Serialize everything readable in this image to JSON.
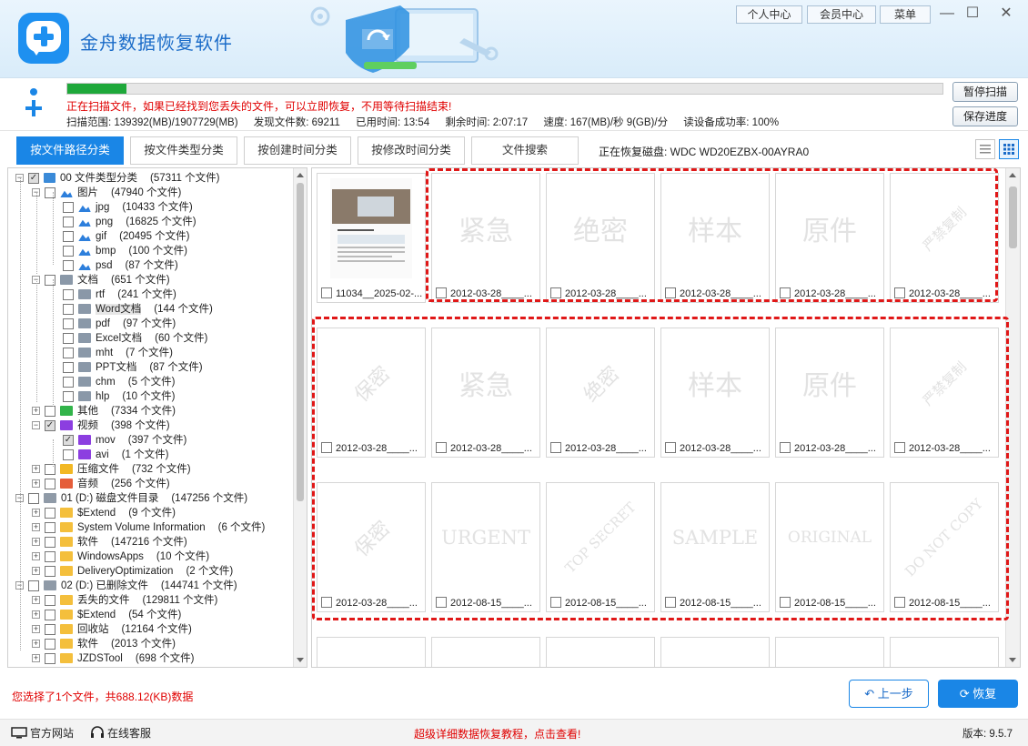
{
  "app": {
    "title": "金舟数据恢复软件",
    "header_buttons": [
      "个人中心",
      "会员中心",
      "菜单"
    ],
    "window_controls": {
      "minimize": "—",
      "maximize": "☐",
      "close": "✕"
    }
  },
  "scan": {
    "progress": 0.068,
    "message": "正在扫描文件，如果已经找到您丢失的文件，可以立即恢复，不用等待扫描结束!",
    "stats": {
      "range": "扫描范围: 139392(MB)/1907729(MB)",
      "found": "发现文件数: 69211",
      "elapsed": "已用时间: 13:54",
      "remaining": "剩余时间: 2:07:17",
      "speed": "速度: 167(MB)/秒  9(GB)/分",
      "success": "读设备成功率: 100%"
    },
    "pause_label": "暂停扫描",
    "save_label": "保存进度"
  },
  "tabs": [
    {
      "label": "按文件路径分类",
      "active": true
    },
    {
      "label": "按文件类型分类",
      "active": false
    },
    {
      "label": "按创建时间分类",
      "active": false
    },
    {
      "label": "按修改时间分类",
      "active": false
    },
    {
      "label": "文件搜索",
      "active": false
    }
  ],
  "disk_label": "正在恢复磁盘: WDC WD20EZBX-00AYRA0",
  "tree": [
    {
      "level": 0,
      "exp": "-",
      "chk": "part",
      "icon": "pc",
      "label": "00 文件类型分类",
      "count": "(57311 个文件)"
    },
    {
      "level": 1,
      "exp": "-",
      "chk": "",
      "icon": "img",
      "label": "图片",
      "count": "(47940 个文件)"
    },
    {
      "level": 2,
      "exp": "",
      "chk": "",
      "icon": "img",
      "label": "jpg",
      "count": "(10433 个文件)"
    },
    {
      "level": 2,
      "exp": "",
      "chk": "",
      "icon": "img",
      "label": "png",
      "count": "(16825 个文件)"
    },
    {
      "level": 2,
      "exp": "",
      "chk": "",
      "icon": "img",
      "label": "gif",
      "count": "(20495 个文件)"
    },
    {
      "level": 2,
      "exp": "",
      "chk": "",
      "icon": "img",
      "label": "bmp",
      "count": "(100 个文件)"
    },
    {
      "level": 2,
      "exp": "",
      "chk": "",
      "icon": "img",
      "label": "psd",
      "count": "(87 个文件)"
    },
    {
      "level": 1,
      "exp": "-",
      "chk": "",
      "icon": "doc",
      "label": "文档",
      "count": "(651 个文件)"
    },
    {
      "level": 2,
      "exp": "",
      "chk": "",
      "icon": "doc",
      "label": "rtf",
      "count": "(241 个文件)"
    },
    {
      "level": 2,
      "exp": "",
      "chk": "",
      "icon": "doc",
      "label": "Word文档",
      "count": "(144 个文件)",
      "hl": true
    },
    {
      "level": 2,
      "exp": "",
      "chk": "",
      "icon": "doc",
      "label": "pdf",
      "count": "(97 个文件)"
    },
    {
      "level": 2,
      "exp": "",
      "chk": "",
      "icon": "doc",
      "label": "Excel文档",
      "count": "(60 个文件)"
    },
    {
      "level": 2,
      "exp": "",
      "chk": "",
      "icon": "doc",
      "label": "mht",
      "count": "(7 个文件)"
    },
    {
      "level": 2,
      "exp": "",
      "chk": "",
      "icon": "doc",
      "label": "PPT文档",
      "count": "(87 个文件)"
    },
    {
      "level": 2,
      "exp": "",
      "chk": "",
      "icon": "doc",
      "label": "chm",
      "count": "(5 个文件)"
    },
    {
      "level": 2,
      "exp": "",
      "chk": "",
      "icon": "doc",
      "label": "hlp",
      "count": "(10 个文件)"
    },
    {
      "level": 1,
      "exp": "+",
      "chk": "",
      "icon": "green",
      "label": "其他",
      "count": "(7334 个文件)"
    },
    {
      "level": 1,
      "exp": "-",
      "chk": "part",
      "icon": "video",
      "label": "视频",
      "count": "(398 个文件)"
    },
    {
      "level": 2,
      "exp": "",
      "chk": "part",
      "icon": "video",
      "label": "mov",
      "count": "(397 个文件)"
    },
    {
      "level": 2,
      "exp": "",
      "chk": "",
      "icon": "video",
      "label": "avi",
      "count": "(1 个文件)"
    },
    {
      "level": 1,
      "exp": "+",
      "chk": "",
      "icon": "zip",
      "label": "压缩文件",
      "count": "(732 个文件)"
    },
    {
      "level": 1,
      "exp": "+",
      "chk": "",
      "icon": "audio",
      "label": "音频",
      "count": "(256 个文件)"
    },
    {
      "level": 0,
      "exp": "-",
      "chk": "",
      "icon": "drive",
      "label": "01 (D:) 磁盘文件目录",
      "count": "(147256 个文件)"
    },
    {
      "level": 1,
      "exp": "+",
      "chk": "",
      "icon": "folder",
      "label": "$Extend",
      "count": "(9 个文件)"
    },
    {
      "level": 1,
      "exp": "+",
      "chk": "",
      "icon": "folder",
      "label": "System Volume Information",
      "count": "(6 个文件)"
    },
    {
      "level": 1,
      "exp": "+",
      "chk": "",
      "icon": "folder",
      "label": "软件",
      "count": "(147216 个文件)"
    },
    {
      "level": 1,
      "exp": "+",
      "chk": "",
      "icon": "folder",
      "label": "WindowsApps",
      "count": "(10 个文件)"
    },
    {
      "level": 1,
      "exp": "+",
      "chk": "",
      "icon": "folder",
      "label": "DeliveryOptimization",
      "count": "(2 个文件)"
    },
    {
      "level": 0,
      "exp": "-",
      "chk": "",
      "icon": "drive",
      "label": "02 (D:) 已删除文件",
      "count": "(144741 个文件)"
    },
    {
      "level": 1,
      "exp": "+",
      "chk": "",
      "icon": "folder",
      "label": "丢失的文件",
      "count": "(129811 个文件)"
    },
    {
      "level": 1,
      "exp": "+",
      "chk": "",
      "icon": "folder",
      "label": "$Extend",
      "count": "(54 个文件)"
    },
    {
      "level": 1,
      "exp": "+",
      "chk": "",
      "icon": "folder",
      "label": "回收站",
      "count": "(12164 个文件)"
    },
    {
      "level": 1,
      "exp": "+",
      "chk": "",
      "icon": "folder",
      "label": "软件",
      "count": "(2013 个文件)"
    },
    {
      "level": 1,
      "exp": "+",
      "chk": "",
      "icon": "folder",
      "label": "JZDSTool",
      "count": "(698 个文件)"
    }
  ],
  "grid": [
    [
      {
        "wm": "",
        "photo": true,
        "caption": "11034__2025-02-..."
      },
      {
        "wm": "紧急",
        "style": "",
        "caption": "2012-03-28____..."
      },
      {
        "wm": "绝密",
        "style": "",
        "caption": "2012-03-28____..."
      },
      {
        "wm": "样本",
        "style": "",
        "caption": "2012-03-28____..."
      },
      {
        "wm": "原件",
        "style": "",
        "caption": "2012-03-28____..."
      },
      {
        "wm": "严禁复制",
        "style": "rot2",
        "caption": "2012-03-28____..."
      }
    ],
    [
      {
        "wm": "保密",
        "style": "rot",
        "caption": "2012-03-28____..."
      },
      {
        "wm": "紧急",
        "style": "",
        "caption": "2012-03-28____..."
      },
      {
        "wm": "绝密",
        "style": "rot",
        "caption": "2012-03-28____..."
      },
      {
        "wm": "样本",
        "style": "",
        "caption": "2012-03-28____..."
      },
      {
        "wm": "原件",
        "style": "",
        "caption": "2012-03-28____..."
      },
      {
        "wm": "严禁复制",
        "style": "rot2",
        "caption": "2012-03-28____..."
      }
    ],
    [
      {
        "wm": "保密",
        "style": "rot",
        "caption": "2012-03-28____..."
      },
      {
        "wm": "URGENT",
        "style": "sm",
        "caption": "2012-08-15____..."
      },
      {
        "wm": "TOP SECRET",
        "style": "rot2",
        "caption": "2012-08-15____..."
      },
      {
        "wm": "SAMPLE",
        "style": "sm",
        "caption": "2012-08-15____..."
      },
      {
        "wm": "ORIGINAL",
        "style": "xs",
        "caption": "2012-08-15____..."
      },
      {
        "wm": "DO NOT COPY",
        "style": "rot2",
        "caption": "2012-08-15____..."
      }
    ],
    [
      {
        "wm": "",
        "style": "",
        "caption": ""
      },
      {
        "wm": "",
        "style": "",
        "caption": ""
      },
      {
        "wm": "",
        "style": "",
        "caption": ""
      },
      {
        "wm": "",
        "style": "",
        "caption": ""
      },
      {
        "wm": "",
        "style": "",
        "caption": ""
      },
      {
        "wm": "",
        "style": "",
        "caption": ""
      }
    ]
  ],
  "bottom": {
    "selection": "您选择了1个文件，共688.12(KB)数据",
    "back_label": "上一步",
    "back_icon": "undo-arrow-icon",
    "recover_label": "恢复",
    "recover_icon": "refresh-icon"
  },
  "footer": {
    "website": "官方网站",
    "support": "在线客服",
    "tutorial": "超级详细数据恢复教程，点击查看!",
    "version": "版本: 9.5.7"
  }
}
